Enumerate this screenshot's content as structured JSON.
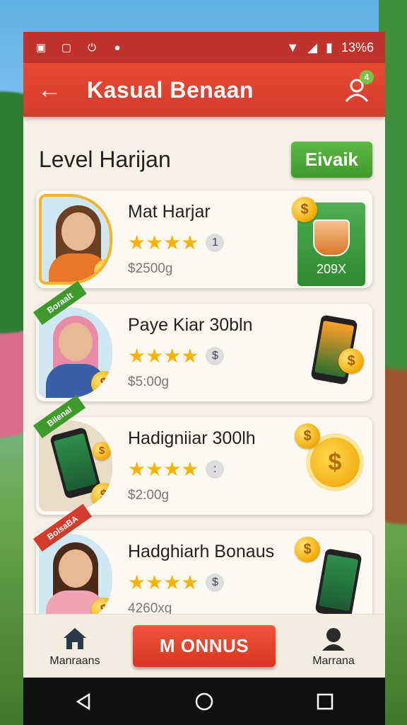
{
  "status_bar": {
    "left_icons": [
      "save-icon",
      "alert-square-icon",
      "power-icon",
      "record-icon"
    ],
    "battery_text": "13%6"
  },
  "app_bar": {
    "title": "Kasual Benaan",
    "notification_count": "4"
  },
  "section": {
    "title": "Level Harijan",
    "action_label": "Eivaik"
  },
  "cards": [
    {
      "title": "Mat Harjar",
      "stars": "★★★★",
      "badge": "1",
      "price": "$2500g",
      "ribbon": "",
      "reward_label": "209X",
      "reward_type": "drink"
    },
    {
      "title": "Paye Kiar 30bln",
      "stars": "★★★★",
      "badge": "$",
      "price": "$5:00g",
      "ribbon": "Boraalt",
      "reward_type": "phone"
    },
    {
      "title": "Hadigniiar 300lh",
      "stars": "★★★★",
      "badge": ":",
      "price": "$2:00g",
      "ribbon": "Bilenal",
      "reward_type": "coins"
    },
    {
      "title": "Hadghiarh Bonaus",
      "stars": "★★★★",
      "badge": "$",
      "price": "4260xg",
      "ribbon": "BolsaBA",
      "reward_type": "phone"
    }
  ],
  "bottom_nav": {
    "left_label": "Manraans",
    "center_button": "M ONNUS",
    "right_label": "Marrana"
  },
  "colors": {
    "primary": "#d33b2c",
    "accent_green": "#3f9a2b",
    "gold": "#f5b400",
    "card_bg": "#fbf8f2"
  }
}
